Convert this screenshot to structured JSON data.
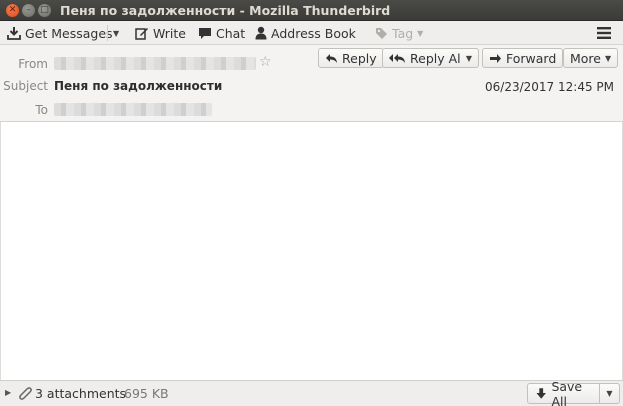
{
  "window": {
    "title": "Пеня по задолженности - Mozilla Thunderbird"
  },
  "toolbar": {
    "get_messages": "Get Messages",
    "write": "Write",
    "chat": "Chat",
    "address_book": "Address Book",
    "tag": "Tag"
  },
  "header": {
    "from_label": "From",
    "subject_label": "Subject",
    "subject_value": "Пеня по задолженности",
    "to_label": "To",
    "date": "06/23/2017 12:45 PM",
    "actions": {
      "reply": "Reply",
      "reply_all": "Reply All",
      "forward": "Forward",
      "more": "More"
    }
  },
  "attachments": {
    "count_text": "3 attachments",
    "size_text": "695 KB",
    "save_all": "Save All"
  },
  "colors": {
    "titlebar": "#3c3b37",
    "close_button": "#e95420",
    "toolbar_bg": "#efeeed"
  }
}
